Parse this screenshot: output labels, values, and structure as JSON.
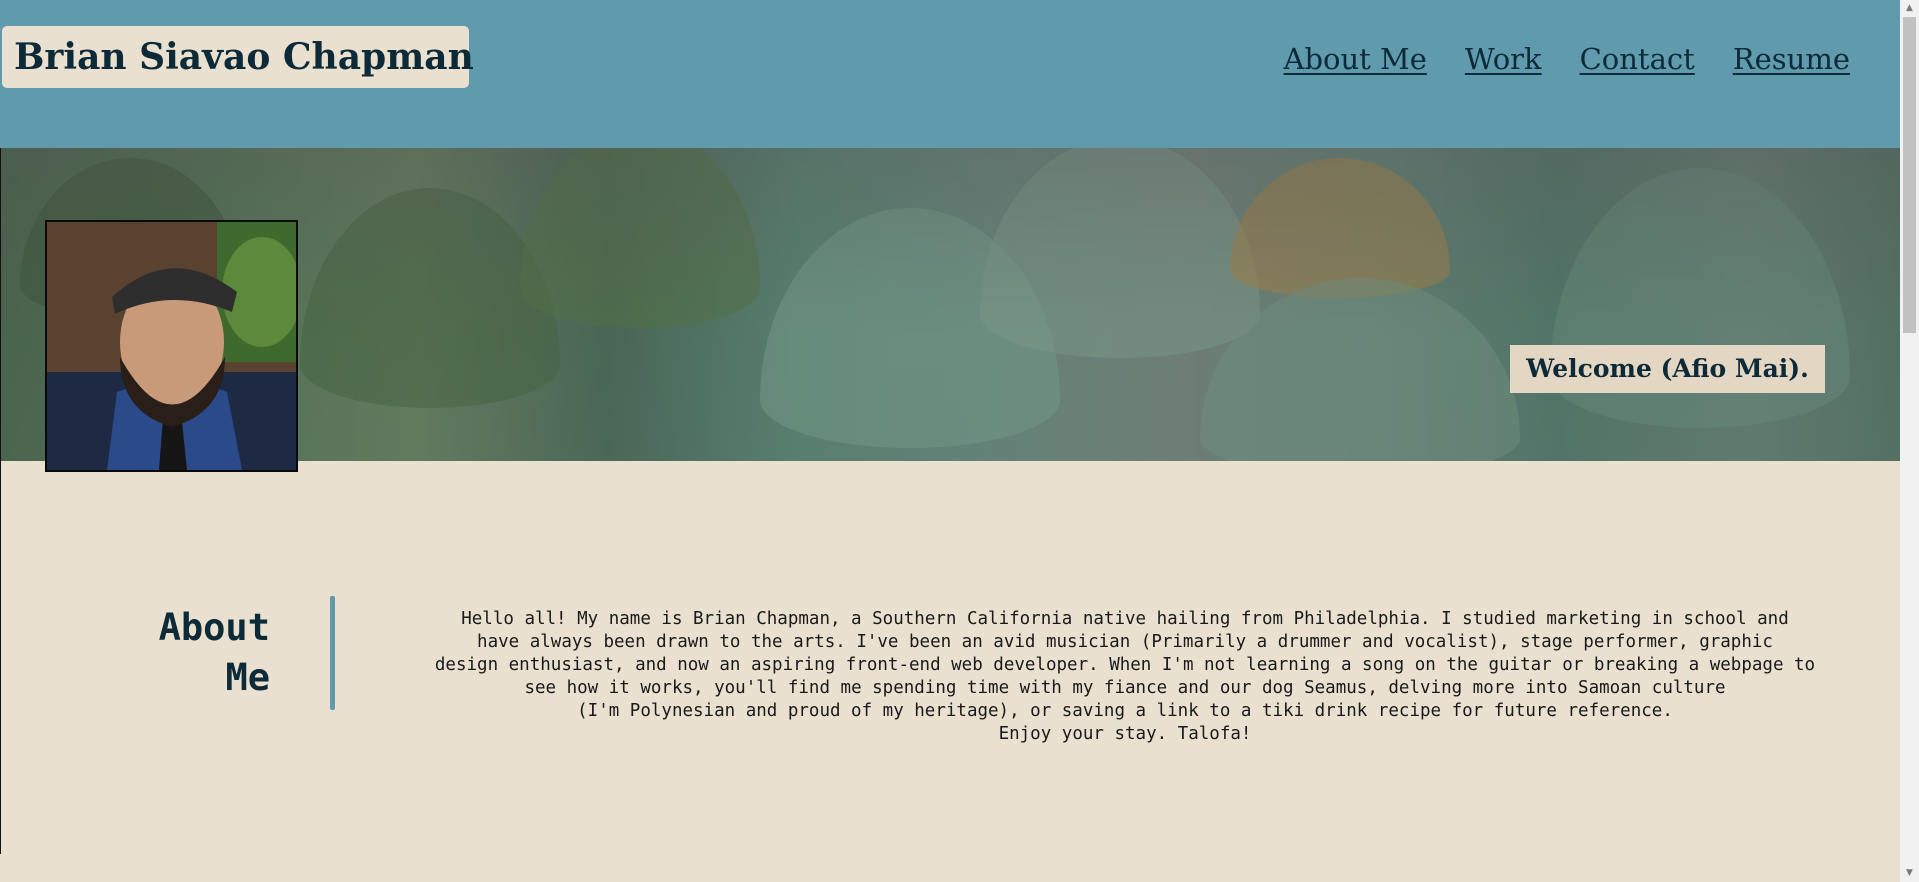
{
  "header": {
    "brand": "Brian Siavao Chapman",
    "nav": [
      {
        "label": "About Me"
      },
      {
        "label": "Work"
      },
      {
        "label": "Contact"
      },
      {
        "label": "Resume"
      }
    ]
  },
  "hero": {
    "welcome": "Welcome (Afio Mai).",
    "portrait_icon": "portrait-photo"
  },
  "about": {
    "title": "About Me",
    "lines": [
      "Hello all! My name is Brian Chapman, a Southern California native hailing from Philadelphia. I studied marketing in school and",
      "have always been drawn to the arts. I've been an avid musician (Primarily a drummer and vocalist), stage performer, graphic",
      "design enthusiast, and now an aspiring front-end web developer. When I'm not learning a song on the guitar or breaking a webpage to",
      "see how it works, you'll find me spending time with my fiance and our dog Seamus, delving more into Samoan culture",
      "(I'm Polynesian and proud of my heritage), or saving a link to a tiki drink recipe for future reference.",
      "Enjoy your stay. Talofa!"
    ]
  },
  "colors": {
    "header_bg": "#5f9aad",
    "page_bg": "#e9e0d0",
    "text_dark": "#0d2a38"
  }
}
